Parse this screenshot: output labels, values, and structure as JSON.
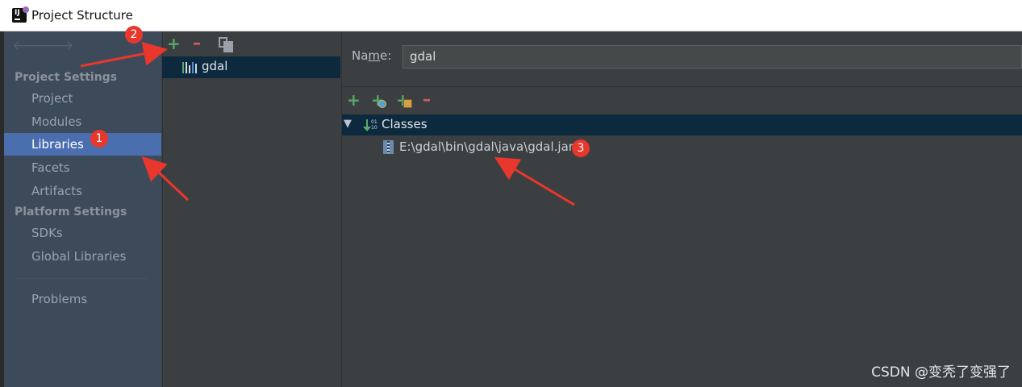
{
  "window": {
    "title": "Project Structure"
  },
  "sidebar": {
    "back_icon": "arrow-left-icon",
    "forward_icon": "arrow-right-icon",
    "project_settings_title": "Project Settings",
    "project_settings_items": [
      "Project",
      "Modules",
      "Libraries",
      "Facets",
      "Artifacts"
    ],
    "platform_settings_title": "Platform Settings",
    "platform_settings_items": [
      "SDKs",
      "Global Libraries"
    ],
    "problems_label": "Problems",
    "selected": "Libraries"
  },
  "libraries_panel": {
    "toolbar": {
      "add_icon": "plus-icon",
      "remove_icon": "minus-icon",
      "copy_icon": "copy-icon"
    },
    "items": [
      {
        "name": "gdal",
        "icon": "library-icon"
      }
    ]
  },
  "detail": {
    "name_label": "Name:",
    "name_value": "gdal",
    "toolbar": {
      "add_icon": "plus-icon",
      "add_special_icon": "plus-globe-icon",
      "add_attach_icon": "plus-attach-icon",
      "remove_icon": "minus-icon"
    },
    "tree": {
      "root_label": "Classes",
      "root_icon": "sort-classes-icon",
      "children": [
        "E:\\gdal\\bin\\gdal\\java\\gdal.jar"
      ]
    }
  },
  "annotations": {
    "badges": [
      "1",
      "2",
      "3"
    ],
    "color": "#e8372c"
  },
  "watermark": "CSDN @变秃了变强了",
  "colors": {
    "sidebar_bg": "#3d4a5a",
    "selection": "#4b6eaf",
    "tree_selection": "#0d293e",
    "panel_bg": "#3c3f41",
    "add_green": "#59a869",
    "remove_red": "#db5c5c"
  }
}
